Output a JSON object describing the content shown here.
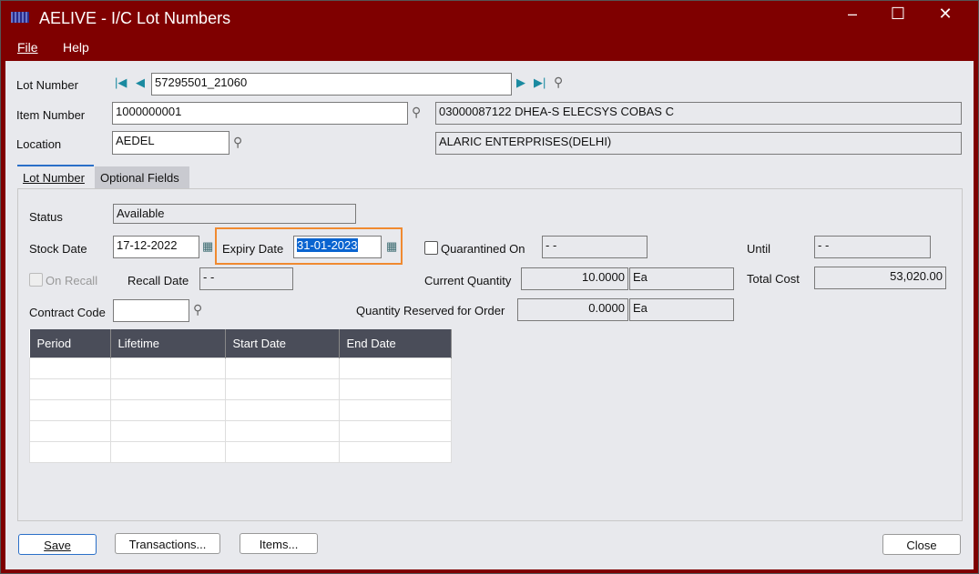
{
  "window": {
    "title": "AELIVE - I/C Lot Numbers",
    "minimize": "–",
    "maximize": "☐",
    "close": "✕"
  },
  "menu": {
    "file": "File",
    "help": "Help"
  },
  "header": {
    "lot_label": "Lot Number",
    "lot_value": "57295501_21060",
    "item_label": "Item Number",
    "item_value": "1000000001",
    "item_desc": "03000087122 DHEA-S ELECSYS COBAS C",
    "location_label": "Location",
    "location_value": "AEDEL",
    "location_desc": "ALARIC ENTERPRISES(DELHI)"
  },
  "tabs": [
    {
      "label": "Lot Number",
      "active": true
    },
    {
      "label": "Optional Fields",
      "active": false
    }
  ],
  "form": {
    "status_label": "Status",
    "status_value": "Available",
    "stock_date_label": "Stock Date",
    "stock_date_value": "17-12-2022",
    "expiry_date_label": "Expiry Date",
    "expiry_date_value": "31-01-2023",
    "quarantined_label": "Quarantined On",
    "quarantined_value": "-  -",
    "until_label": "Until",
    "until_value": "-  -",
    "on_recall_label": "On Recall",
    "recall_date_label": "Recall Date",
    "recall_date_value": "-  -",
    "current_qty_label": "Current Quantity",
    "current_qty_value": "10.0000",
    "current_qty_uom": "Ea",
    "total_cost_label": "Total Cost",
    "total_cost_value": "53,020.00",
    "contract_code_label": "Contract Code",
    "contract_code_value": "",
    "reserved_label": "Quantity Reserved for Order",
    "reserved_value": "0.0000",
    "reserved_uom": "Ea"
  },
  "grid": {
    "columns": [
      "Period",
      "Lifetime",
      "Start Date",
      "End Date"
    ]
  },
  "buttons": {
    "save": "Save",
    "transactions": "Transactions...",
    "items": "Items...",
    "close": "Close"
  },
  "highlight_color": "#f08a30"
}
